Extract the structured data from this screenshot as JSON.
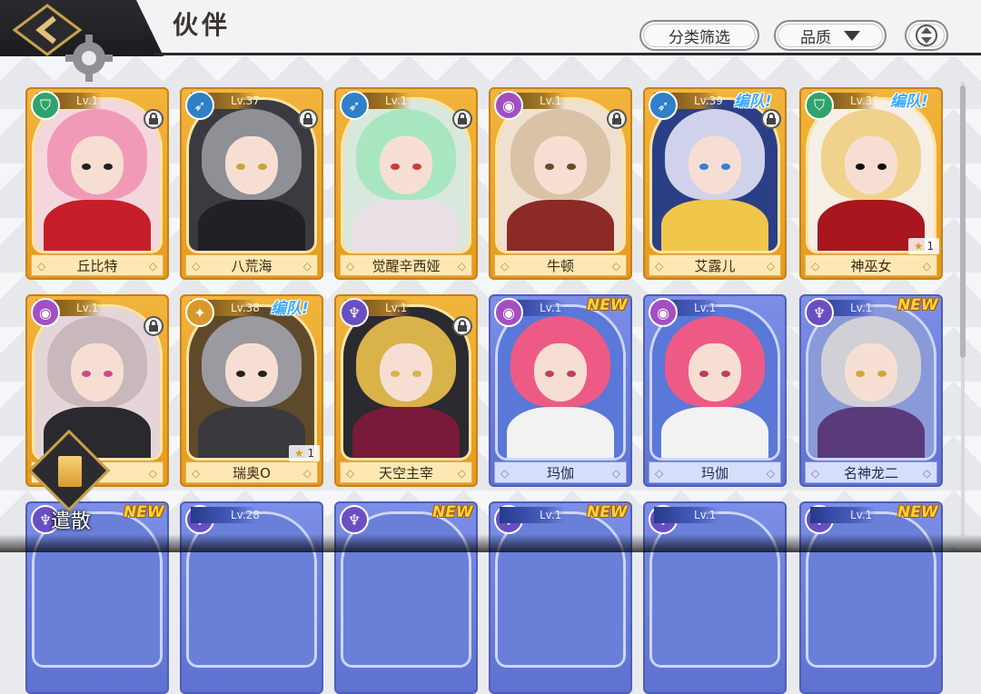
{
  "header": {
    "title": "伙伴",
    "filter_label": "分类筛选",
    "quality_label": "品质"
  },
  "colors": {
    "gold_card": "#f2b43c",
    "blue_card": "#7c8ee6",
    "team_badge": "#3aa9ff",
    "new_badge": "#ffd13a"
  },
  "cards": [
    {
      "name": "丘比特",
      "level": "Lv.1",
      "frame": "gold",
      "class_icon": "shield-icon",
      "class_color": "#2fa36b",
      "locked": true,
      "team": "",
      "new": "",
      "stars": "",
      "hair": "#f19ab8",
      "body": "#c61f2a",
      "bg": "#f4d7dc",
      "eye": "#222"
    },
    {
      "name": "八荒海",
      "level": "Lv.37",
      "frame": "gold",
      "class_icon": "bow-icon",
      "class_color": "#2f7fc9",
      "locked": true,
      "team": "",
      "new": "",
      "stars": "",
      "hair": "#8f8f96",
      "body": "#202124",
      "bg": "#3a3a40",
      "eye": "#c9a43a"
    },
    {
      "name": "觉醒辛西娅",
      "level": "Lv.1",
      "frame": "gold",
      "class_icon": "bow-icon",
      "class_color": "#2f7fc9",
      "locked": true,
      "team": "",
      "new": "",
      "stars": "",
      "hair": "#a8e6c2",
      "body": "#e8e0e4",
      "bg": "#d9e8dd",
      "eye": "#d23a3a"
    },
    {
      "name": "牛顿",
      "level": "Lv.1",
      "frame": "gold",
      "class_icon": "orb-icon",
      "class_color": "#a34fc2",
      "locked": true,
      "team": "",
      "new": "",
      "stars": "",
      "hair": "#d9c2a6",
      "body": "#8c2a26",
      "bg": "#f0e0d0",
      "eye": "#6a4a2a"
    },
    {
      "name": "艾露儿",
      "level": "Lv.39",
      "frame": "gold",
      "class_icon": "bow-icon",
      "class_color": "#2f7fc9",
      "locked": true,
      "team": "编队!",
      "new": "",
      "stars": "",
      "hair": "#cfd2ea",
      "body": "#f0c74a",
      "bg": "#2a3f86",
      "eye": "#3a7fd6"
    },
    {
      "name": "神巫女",
      "level": "Lv.39",
      "frame": "gold",
      "class_icon": "shield-icon",
      "class_color": "#2fa36b",
      "locked": false,
      "team": "编队!",
      "new": "",
      "stars": "1",
      "hair": "#f1d28c",
      "body": "#a8161e",
      "bg": "#f6efe6",
      "eye": "#111"
    },
    {
      "name": "",
      "level": "Lv.1",
      "frame": "gold",
      "class_icon": "orb-icon",
      "class_color": "#a34fc2",
      "locked": true,
      "team": "",
      "new": "",
      "stars": "",
      "hair": "#c8b8bc",
      "body": "#2a2a2e",
      "bg": "#e4d6d8",
      "eye": "#c94e86"
    },
    {
      "name": "瑞奥O",
      "level": "Lv.38",
      "frame": "gold",
      "class_icon": "sword-icon",
      "class_color": "#d79a2a",
      "locked": false,
      "team": "编队!",
      "new": "",
      "stars": "1",
      "hair": "#9a9aa0",
      "body": "#3a3a3e",
      "bg": "#5e4a2a",
      "eye": "#222"
    },
    {
      "name": "天空主宰",
      "level": "Lv.1",
      "frame": "gold",
      "class_icon": "staff-icon",
      "class_color": "#6a4fc2",
      "locked": true,
      "team": "",
      "new": "",
      "stars": "",
      "hair": "#d9b24a",
      "body": "#7a1a3a",
      "bg": "#2a2a30",
      "eye": "#d9b24a"
    },
    {
      "name": "玛伽",
      "level": "Lv.1",
      "frame": "blue",
      "class_icon": "orb-icon",
      "class_color": "#a34fc2",
      "locked": false,
      "team": "",
      "new": "NEW",
      "stars": "",
      "hair": "#ee5a86",
      "body": "#f2f2f2",
      "bg": "#5a78d8",
      "eye": "#c03a6a"
    },
    {
      "name": "玛伽",
      "level": "Lv.1",
      "frame": "blue",
      "class_icon": "orb-icon",
      "class_color": "#a34fc2",
      "locked": false,
      "team": "",
      "new": "",
      "stars": "",
      "hair": "#ee5a86",
      "body": "#f2f2f2",
      "bg": "#5a78d8",
      "eye": "#c03a6a"
    },
    {
      "name": "名神龙二",
      "level": "Lv.1",
      "frame": "blue",
      "class_icon": "staff-icon",
      "class_color": "#6a4fc2",
      "locked": false,
      "team": "",
      "new": "NEW",
      "stars": "",
      "hair": "#d0d0d6",
      "body": "#5a3a7a",
      "bg": "#8a9ad8",
      "eye": "#d0a63a"
    }
  ],
  "partial_row": [
    {
      "level": "",
      "frame": "blue",
      "new": "NEW"
    },
    {
      "level": "Lv.28",
      "frame": "blue",
      "new": ""
    },
    {
      "level": "",
      "frame": "blue",
      "new": "NEW"
    },
    {
      "level": "Lv.1",
      "frame": "blue",
      "new": "NEW"
    },
    {
      "level": "Lv.1",
      "frame": "blue",
      "new": ""
    },
    {
      "level": "Lv.1",
      "frame": "blue",
      "new": "NEW"
    }
  ],
  "disband": {
    "label": "遣散"
  }
}
